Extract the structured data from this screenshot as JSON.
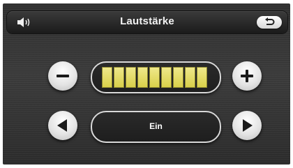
{
  "header": {
    "title": "Lautstärke",
    "left_icon": "speaker-icon",
    "back_icon": "back-arrow-icon"
  },
  "volume": {
    "decrease_icon": "minus-icon",
    "increase_icon": "plus-icon",
    "level_segments_filled": 9,
    "level_segments_total": 9,
    "segment_color": "#e6de6a"
  },
  "mode": {
    "value": "Ein",
    "prev_icon": "left-triangle-icon",
    "next_icon": "right-triangle-icon"
  }
}
